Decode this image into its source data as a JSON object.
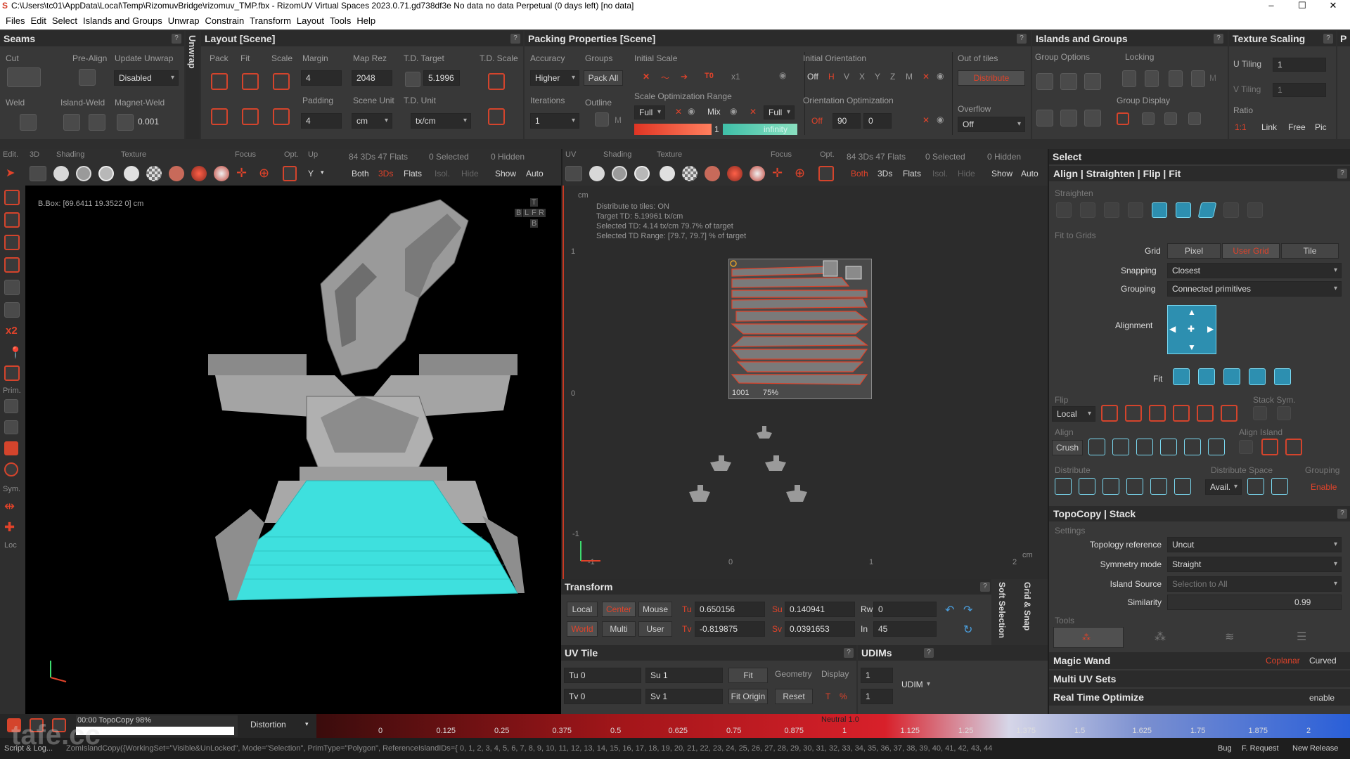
{
  "titlebar": {
    "title": "C:\\Users\\tc01\\AppData\\Local\\Temp\\RizomuvBridge\\rizomuv_TMP.fbx - RizomUV  Virtual Spaces 2023.0.71.gd738df3e No data no data Perpetual  (0 days left) [no data]",
    "logo": "S",
    "minimize": "–",
    "maximize": "☐",
    "close": "✕"
  },
  "menu": [
    "Files",
    "Edit",
    "Select",
    "Islands and Groups",
    "Unwrap",
    "Constrain",
    "Transform",
    "Layout",
    "Tools",
    "Help"
  ],
  "seams": {
    "title": "Seams",
    "cut": "Cut",
    "pre_align": "Pre-Align",
    "update_unwrap": "Update Unwrap",
    "update_value": "Disabled",
    "weld": "Weld",
    "island_weld": "Island-Weld",
    "magnet_weld": "Magnet-Weld",
    "magnet_value": "0.001",
    "unwrap_tab": "Unwrap"
  },
  "layout": {
    "title": "Layout [Scene]",
    "pack": "Pack",
    "fit": "Fit",
    "scale": "Scale",
    "margin": "Margin",
    "margin_value": "4",
    "map_rez": "Map Rez",
    "map_rez_value": "2048",
    "td_target": "T.D. Target",
    "td_target_value": "5.1996",
    "td_scale": "T.D. Scale",
    "padding": "Padding",
    "padding_value": "4",
    "scene_unit": "Scene Unit",
    "scene_unit_value": "cm",
    "td_unit": "T.D. Unit",
    "td_unit_value": "tx/cm"
  },
  "packing": {
    "title": "Packing Properties [Scene]",
    "accuracy": "Accuracy",
    "accuracy_value": "Higher",
    "groups": "Groups",
    "pack_all": "Pack All",
    "initial_scale": "Initial Scale",
    "t0": "T0",
    "x1": "x1",
    "iterations": "Iterations",
    "iterations_value": "1",
    "outline": "Outline",
    "m": "M",
    "scale_opt_range": "Scale Optimization Range",
    "full1": "Full",
    "mix": "Mix",
    "full2": "Full",
    "one": "1",
    "infinity": "infinity",
    "initial_orientation": "Initial Orientation",
    "off": "Off",
    "h": "H",
    "v": "V",
    "x": "X",
    "y": "Y",
    "z": "Z",
    "m2": "M",
    "orientation_opt": "Orientation Optimization",
    "off2": "Off",
    "ninety": "90",
    "zero": "0",
    "out_of_tiles": "Out of tiles",
    "distribute": "Distribute",
    "overflow": "Overflow",
    "overflow_value": "Off"
  },
  "islands": {
    "title": "Islands and Groups",
    "group_options": "Group Options",
    "locking": "Locking",
    "group_display": "Group Display",
    "m": "M"
  },
  "texture_scaling": {
    "title": "Texture Scaling",
    "u_tiling": "U Tiling",
    "u_value": "1",
    "v_tiling": "V Tiling",
    "v_value": "1",
    "ratio": "Ratio",
    "ratio_value": "1:1",
    "link": "Link",
    "free": "Free",
    "pic": "Pic",
    "p": "P"
  },
  "view3d": {
    "edit": "Edit.",
    "three_d": "3D",
    "shading": "Shading",
    "texture": "Texture",
    "focus": "Focus",
    "opt": "Opt.",
    "up": "Up",
    "y": "Y",
    "stats": "84 3Ds 47 Flats",
    "selected": "0 Selected",
    "hidden": "0 Hidden",
    "both": "Both",
    "threeds": "3Ds",
    "flats": "Flats",
    "isol": "Isol.",
    "hide": "Hide",
    "show": "Show",
    "auto": "Auto",
    "bbox": "B.Box: [69.6411 19.3522 0] cm",
    "nav": [
      "T",
      "B",
      "L",
      "F",
      "R",
      "B"
    ],
    "side": [
      "x2",
      "Prim.",
      "Sym.",
      "Loc"
    ]
  },
  "viewuv": {
    "uv": "UV",
    "shading": "Shading",
    "texture": "Texture",
    "focus": "Focus",
    "opt": "Opt.",
    "stats": "84 3Ds 47 Flats",
    "selected": "0 Selected",
    "hidden": "0 Hidden",
    "both": "Both",
    "threeds": "3Ds",
    "flats": "Flats",
    "isol": "Isol.",
    "hide": "Hide",
    "show": "Show",
    "auto": "Auto",
    "info": [
      "Distribute to tiles: ON",
      "Target TD: 5.19961 tx/cm",
      "Selected TD: 4.14 tx/cm 79.7% of target",
      "Selected TD Range: [79.7, 79.7] % of target"
    ],
    "cm_top": "cm",
    "cm_right": "cm",
    "tile_label": "1001",
    "tile_pct": "75%",
    "axis_1": "1",
    "axis_0": "0",
    "axis_m1": "-1",
    "x0": "0",
    "x1": "1",
    "x2": "2",
    "xm1": "-1"
  },
  "transform": {
    "title": "Transform",
    "local": "Local",
    "center": "Center",
    "mouse": "Mouse",
    "world": "World",
    "multi": "Multi",
    "user": "User",
    "tu": "Tu",
    "tu_value": "0.650156",
    "tv": "Tv",
    "tv_value": "-0.819875",
    "su": "Su",
    "su_value": "0.140941",
    "sv": "Sv",
    "sv_value": "0.0391653",
    "rw": "Rw",
    "rw_value": "0",
    "in": "In",
    "in_value": "45",
    "soft_selection": "Soft Selection",
    "grid_snap": "Grid & Snap"
  },
  "uvtile": {
    "title": "UV Tile",
    "tu": "Tu 0",
    "tv": "Tv 0",
    "su": "Su 1",
    "sv": "Sv 1",
    "fit": "Fit",
    "fit_origin": "Fit Origin",
    "geometry": "Geometry",
    "display": "Display",
    "reset": "Reset",
    "t": "T",
    "pct": "%"
  },
  "udims": {
    "title": "UDIMs",
    "v1": "1",
    "v2": "1",
    "udim": "UDIM"
  },
  "select": {
    "title": "Select",
    "section": "Align | Straighten | Flip | Fit",
    "straighten": "Straighten",
    "fit_to_grids": "Fit to Grids",
    "grid": "Grid",
    "pixel": "Pixel",
    "user_grid": "User Grid",
    "tile": "Tile",
    "snapping": "Snapping",
    "snapping_value": "Closest",
    "grouping": "Grouping",
    "grouping_value": "Connected primitives",
    "alignment": "Alignment",
    "fit": "Fit",
    "flip": "Flip",
    "stack_sym": "Stack Sym.",
    "local": "Local",
    "align": "Align",
    "align_island": "Align Island",
    "crush": "Crush",
    "distribute": "Distribute",
    "distribute_space": "Distribute Space",
    "grouping2": "Grouping",
    "avail": "Avail.",
    "enable": "Enable"
  },
  "topocopy": {
    "title": "TopoCopy | Stack",
    "settings": "Settings",
    "topology_reference": "Topology reference",
    "topology_value": "Uncut",
    "symmetry_mode": "Symmetry mode",
    "symmetry_value": "Straight",
    "island_source": "Island Source",
    "island_value": "Selection to All",
    "similarity": "Similarity",
    "similarity_value": "0.99",
    "tools": "Tools"
  },
  "bottom_sections": {
    "magic_wand": "Magic Wand",
    "coplanar": "Coplanar",
    "curved": "Curved",
    "multi_uv_sets": "Multi UV Sets",
    "real_time": "Real Time Optimize",
    "enable": "enable"
  },
  "status": {
    "progress_text": "00:00 TopoCopy 98%",
    "progress": 0.98,
    "distortion": "Distortion",
    "neutral": "Neutral 1.0",
    "ticks": [
      "0",
      "0.125",
      "0.25",
      "0.375",
      "0.5",
      "0.625",
      "0.75",
      "0.875",
      "1",
      "1.125",
      "1.25",
      "1.375",
      "1.5",
      "1.625",
      "1.75",
      "1.875",
      "2"
    ],
    "script_log": "Script & Log...",
    "command": "ZomIslandCopy({WorkingSet=\"Visible&UnLocked\", Mode=\"Selection\", PrimType=\"Polygon\", ReferenceIslandIDs={ 0, 1, 2, 3, 4, 5, 6, 7, 8, 9, 10, 11, 12, 13, 14, 15, 16, 17, 18, 19, 20, 21, 22, 23, 24, 25, 26, 27, 28, 29, 30, 31, 32, 33, 34, 35, 36, 37, 38, 39, 40, 41, 42, 43, 44",
    "bug": "Bug",
    "f_request": "F. Request",
    "new_release": "New Release",
    "watermark": "tafe.cc"
  },
  "colors": {
    "accent": "#e2432a",
    "cyan": "#3ee0de",
    "panel": "#383838",
    "viewport": "#000000"
  }
}
